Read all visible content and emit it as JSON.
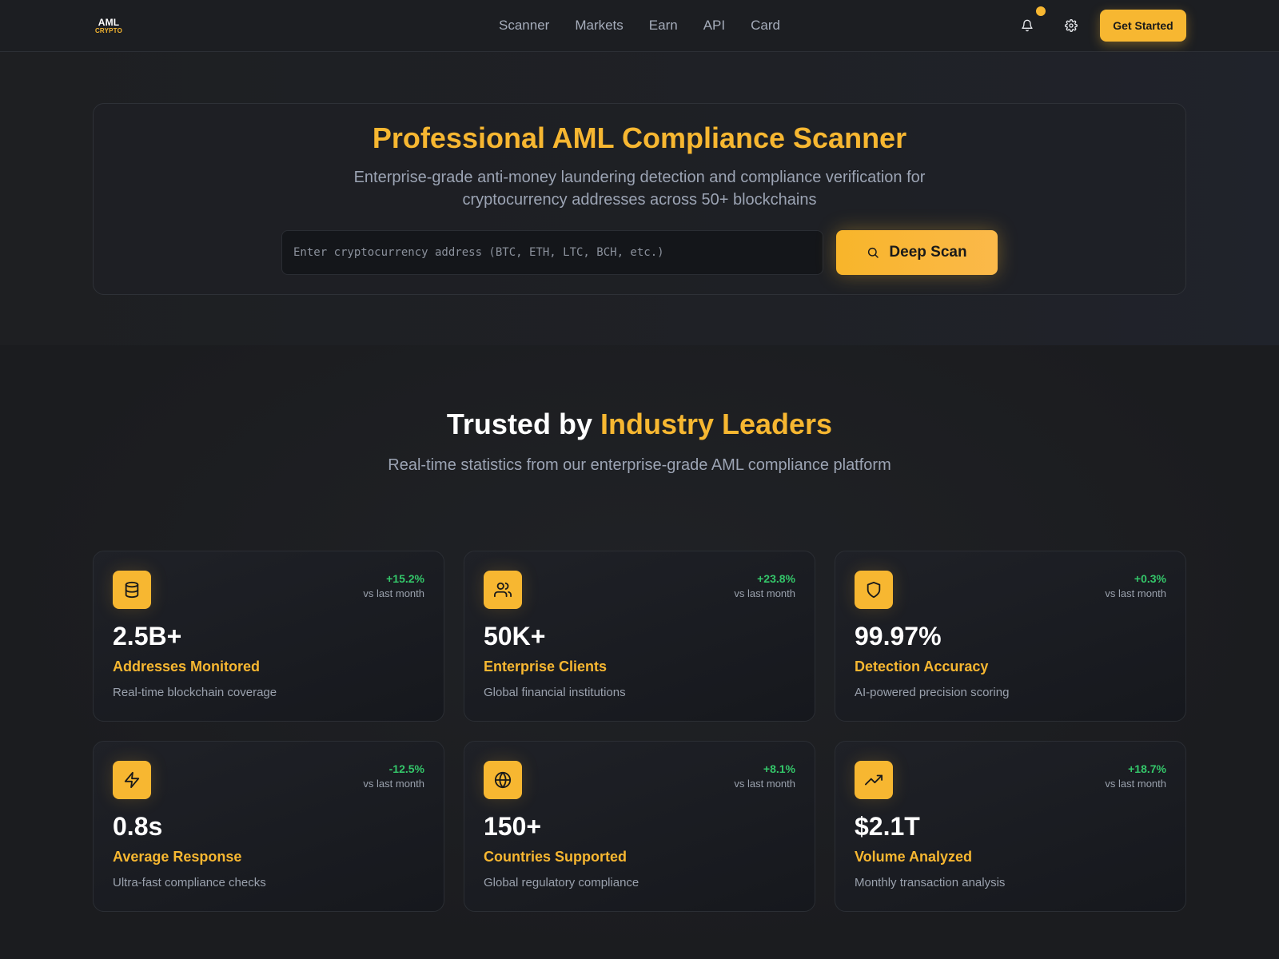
{
  "header": {
    "logo_top": "AML",
    "logo_bottom": "CRYPTO",
    "nav": [
      "Scanner",
      "Markets",
      "Earn",
      "API",
      "Card"
    ],
    "cta": "Get Started",
    "icons": [
      "bell-icon",
      "gear-icon"
    ]
  },
  "hero": {
    "title": "Professional AML Compliance Scanner",
    "subtitle": "Enterprise-grade anti-money laundering detection and compliance verification for cryptocurrency addresses across 50+ blockchains",
    "input_placeholder": "Enter cryptocurrency address (BTC, ETH, LTC, BCH, etc.)",
    "input_value": "",
    "button_label": "Deep Scan",
    "button_icon": "search-icon"
  },
  "stats": {
    "title_part1": "Trusted by ",
    "title_accent": "Industry Leaders",
    "subtitle": "Real-time statistics from our enterprise-grade AML compliance platform",
    "cards": [
      {
        "icon": "database-icon",
        "change": "+15.2%",
        "vs": "vs last month",
        "value": "2.5B+",
        "label": "Addresses Monitored",
        "desc": "Real-time blockchain coverage"
      },
      {
        "icon": "users-icon",
        "change": "+23.8%",
        "vs": "vs last month",
        "value": "50K+",
        "label": "Enterprise Clients",
        "desc": "Global financial institutions"
      },
      {
        "icon": "shield-icon",
        "change": "+0.3%",
        "vs": "vs last month",
        "value": "99.97%",
        "label": "Detection Accuracy",
        "desc": "AI-powered precision scoring"
      },
      {
        "icon": "lightning-icon",
        "change": "-12.5%",
        "vs": "vs last month",
        "value": "0.8s",
        "label": "Average Response",
        "desc": "Ultra-fast compliance checks"
      },
      {
        "icon": "globe-icon",
        "change": "+8.1%",
        "vs": "vs last month",
        "value": "150+",
        "label": "Countries Supported",
        "desc": "Global regulatory compliance"
      },
      {
        "icon": "trending-up-icon",
        "change": "+18.7%",
        "vs": "vs last month",
        "value": "$2.1T",
        "label": "Volume Analyzed",
        "desc": "Monthly transaction analysis"
      }
    ]
  },
  "colors": {
    "accent": "#f7b731",
    "background": "#1d1e21",
    "positive": "#34c76a",
    "muted_text": "#9aa1ad"
  }
}
